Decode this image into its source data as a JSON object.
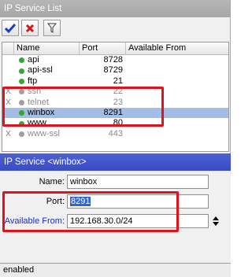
{
  "list_window": {
    "title": "IP Service List",
    "toolbar": {
      "enable_icon": "checkmark-icon",
      "disable_icon": "x-icon",
      "filter_icon": "funnel-icon"
    },
    "columns": [
      "Name",
      "Port",
      "Available From"
    ],
    "rows": [
      {
        "flag": "",
        "name": "api",
        "port": "8728",
        "available_from": "",
        "status": "enabled"
      },
      {
        "flag": "",
        "name": "api-ssl",
        "port": "8729",
        "available_from": "",
        "status": "enabled"
      },
      {
        "flag": "",
        "name": "ftp",
        "port": "21",
        "available_from": "",
        "status": "enabled"
      },
      {
        "flag": "X",
        "name": "ssh",
        "port": "22",
        "available_from": "",
        "status": "disabled"
      },
      {
        "flag": "X",
        "name": "telnet",
        "port": "23",
        "available_from": "",
        "status": "disabled"
      },
      {
        "flag": "",
        "name": "winbox",
        "port": "8291",
        "available_from": "",
        "status": "selected"
      },
      {
        "flag": "",
        "name": "www",
        "port": "80",
        "available_from": "",
        "status": "enabled"
      },
      {
        "flag": "X",
        "name": "www-ssl",
        "port": "443",
        "available_from": "",
        "status": "disabled"
      }
    ]
  },
  "detail_window": {
    "title": "IP Service <winbox>",
    "name_label": "Name:",
    "name_value": "winbox",
    "port_label": "Port:",
    "port_value": "8291",
    "available_from_label": "Available From:",
    "available_from_value": "192.168.30.0/24",
    "status_text": "enabled"
  },
  "colors": {
    "highlight": "#e0121b",
    "selected_row": "#a3bde5",
    "active_title": "#3a4cc4",
    "enabled_dot": "#35a535"
  }
}
